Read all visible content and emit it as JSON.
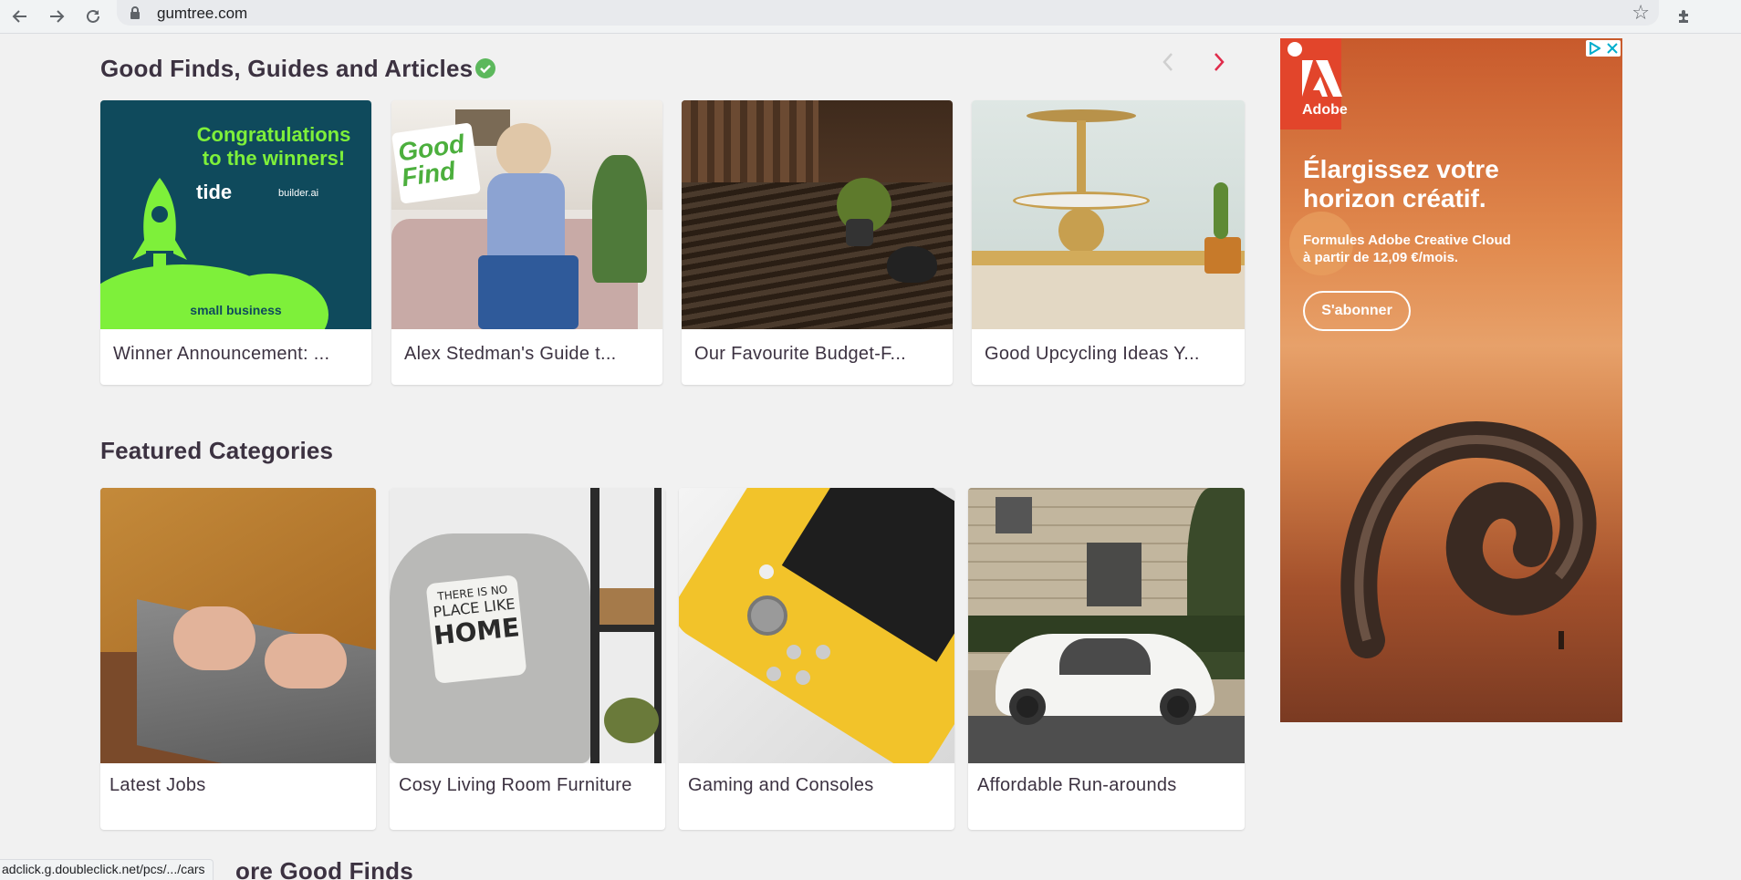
{
  "browser": {
    "url": "gumtree.com",
    "status_url": "adclick.g.doubleclick.net/pcs/.../cars"
  },
  "good_finds": {
    "title": "Good Finds, Guides and Articles",
    "cards": [
      {
        "label": "Winner Announcement: ...",
        "image_text_1": "Congratulations",
        "image_text_2": "to the winners!",
        "image_brand_1": "tide",
        "image_brand_2": "builder.ai",
        "image_bottom": "small business"
      },
      {
        "label": "Alex Stedman's Guide t...",
        "image_badge_1": "Good",
        "image_badge_2": "Find"
      },
      {
        "label": "Our Favourite Budget-F..."
      },
      {
        "label": "Good Upcycling Ideas Y..."
      }
    ]
  },
  "featured": {
    "title": "Featured Categories",
    "cards": [
      {
        "label": "Latest Jobs"
      },
      {
        "label": "Cosy Living Room Furniture",
        "cushion_1": "THERE IS NO",
        "cushion_2": "PLACE LIKE",
        "cushion_3": "HOME"
      },
      {
        "label": "Gaming and Consoles"
      },
      {
        "label": "Affordable Run-arounds"
      }
    ]
  },
  "more": {
    "title_partial": "ore Good Finds"
  },
  "ad": {
    "brand": "Adobe",
    "headline_1": "Élargissez votre",
    "headline_2": "horizon créatif.",
    "sub_1": "Formules Adobe Creative Cloud",
    "sub_2": "à partir de 12,09 €/mois.",
    "cta": "S'abonner"
  },
  "colors": {
    "accent_red": "#e02b4b",
    "verified_green": "#5cb85c",
    "page_bg": "#f1f1f1",
    "text": "#3c3241"
  },
  "icons": [
    "back-icon",
    "forward-icon",
    "reload-icon",
    "lock-icon",
    "star-icon",
    "extensions-icon",
    "verified-icon",
    "chevron-left-icon",
    "chevron-right-icon",
    "adchoices-icon",
    "close-icon"
  ]
}
